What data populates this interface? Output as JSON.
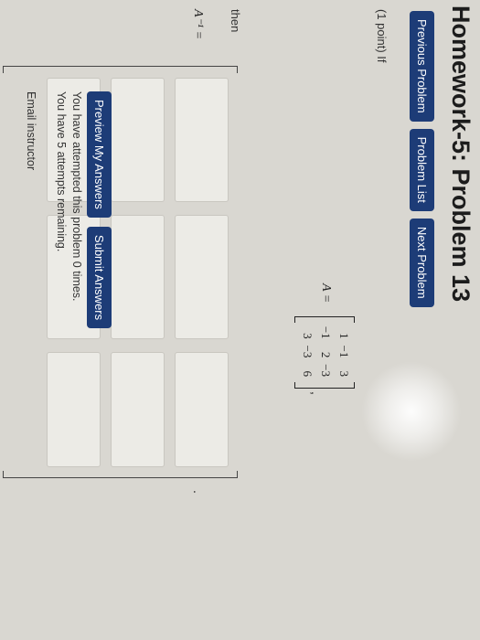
{
  "page_title": "Homework-5: Problem 13",
  "nav": {
    "previous": "Previous Problem",
    "list": "Problem List",
    "next": "Next Problem"
  },
  "problem": {
    "prompt": "(1 point) If",
    "matrix_label": "A =",
    "matrix": [
      [
        "1",
        "−1",
        "3"
      ],
      [
        "−1",
        "2",
        "−3"
      ],
      [
        "3",
        "−3",
        "6"
      ]
    ],
    "then": "then",
    "inverse_label": "A⁻¹ ="
  },
  "actions": {
    "preview": "Preview My Answers",
    "submit": "Submit Answers"
  },
  "status": {
    "attempted": "You have attempted this problem 0 times.",
    "remaining": "You have 5 attempts remaining."
  },
  "email_link": "Email instructor"
}
